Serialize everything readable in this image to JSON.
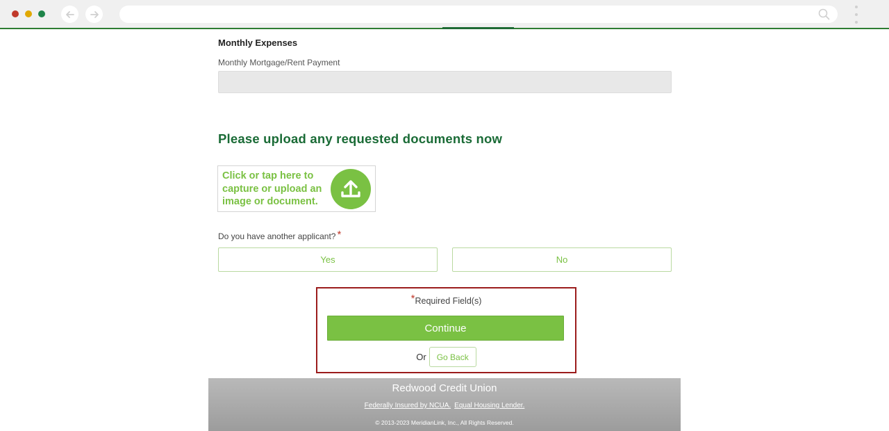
{
  "browser": {
    "url": ""
  },
  "form": {
    "section_heading": "Monthly Expenses",
    "mortgage_label": "Monthly Mortgage/Rent Payment",
    "mortgage_value": ""
  },
  "upload": {
    "heading": "Please upload any requested documents now",
    "box_text": "Click or tap here to capture or upload an image or document."
  },
  "applicant_question": {
    "label": "Do you have another applicant?",
    "required_mark": "*",
    "yes_label": "Yes",
    "no_label": "No"
  },
  "actions": {
    "required_mark": "*",
    "required_note": "Required Field(s)",
    "continue_label": "Continue",
    "or_text": "Or",
    "go_back_label": "Go Back"
  },
  "footer": {
    "title": "Redwood Credit Union",
    "link_ncua": "Federally Insured by NCUA.",
    "link_housing": "Equal Housing Lender.",
    "copyright": "© 2013-2023 MeridianLink, Inc., All Rights Reserved."
  },
  "colors": {
    "brand_green": "#7ac143",
    "heading_green": "#1a6b36",
    "highlight_red": "#9b1c1c"
  }
}
